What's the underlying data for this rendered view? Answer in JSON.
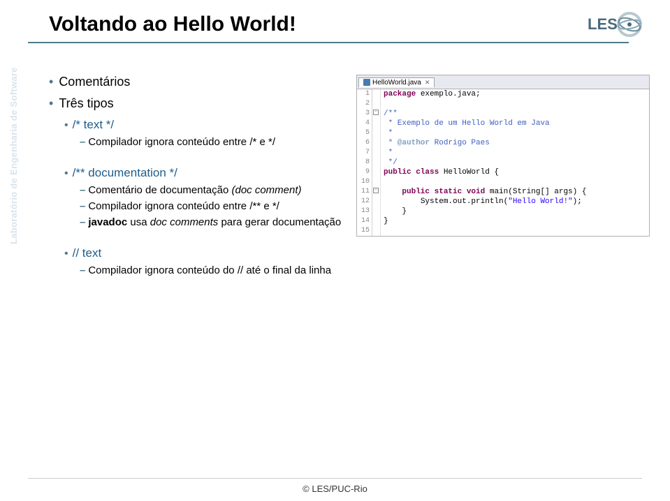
{
  "title": "Voltando ao Hello World!",
  "sidebar": "Laboratório de Engenharia de Software",
  "logo": {
    "text": "LES"
  },
  "bullets": {
    "comentarios": "Comentários",
    "tresTipos": "Três tipos",
    "type1": {
      "head": "/* text */",
      "sub": "Compilador ignora conteúdo entre /* e */"
    },
    "type2": {
      "head": "/** documentation */",
      "s1": "Comentário de documentação",
      "s1i": "(doc comment)",
      "s2": "Compilador ignora conteúdo entre /** e */",
      "s3a": "javadoc",
      "s3b": " usa ",
      "s3c": "doc comments",
      "s3d": " para gerar documentação"
    },
    "type3": {
      "head": "// text",
      "sub": "Compilador ignora conteúdo do // até o final da linha"
    }
  },
  "editor": {
    "tab": "HelloWorld.java",
    "lines": [
      {
        "pkg": "package",
        "rest": " exemplo.java;"
      },
      "",
      "/**",
      " * Exemplo de um Hello World em Java",
      " *",
      {
        "tag": " * @author",
        "rest": " Rodrigo Paes"
      },
      " *",
      " */",
      {
        "kw1": "public",
        "kw2": " class",
        "rest": " HelloWorld {"
      },
      "",
      {
        "indent": "    ",
        "kw1": "public",
        "kw2": " static",
        "kw3": " void",
        "rest": " main(String[] args) {"
      },
      {
        "indent": "        ",
        "pre": "System.out.println(",
        "str": "\"Hello World!\"",
        "post": ");"
      },
      {
        "indent": "    ",
        "rest": "}"
      },
      {
        "rest": "}"
      }
    ]
  },
  "footer": "© LES/PUC-Rio"
}
